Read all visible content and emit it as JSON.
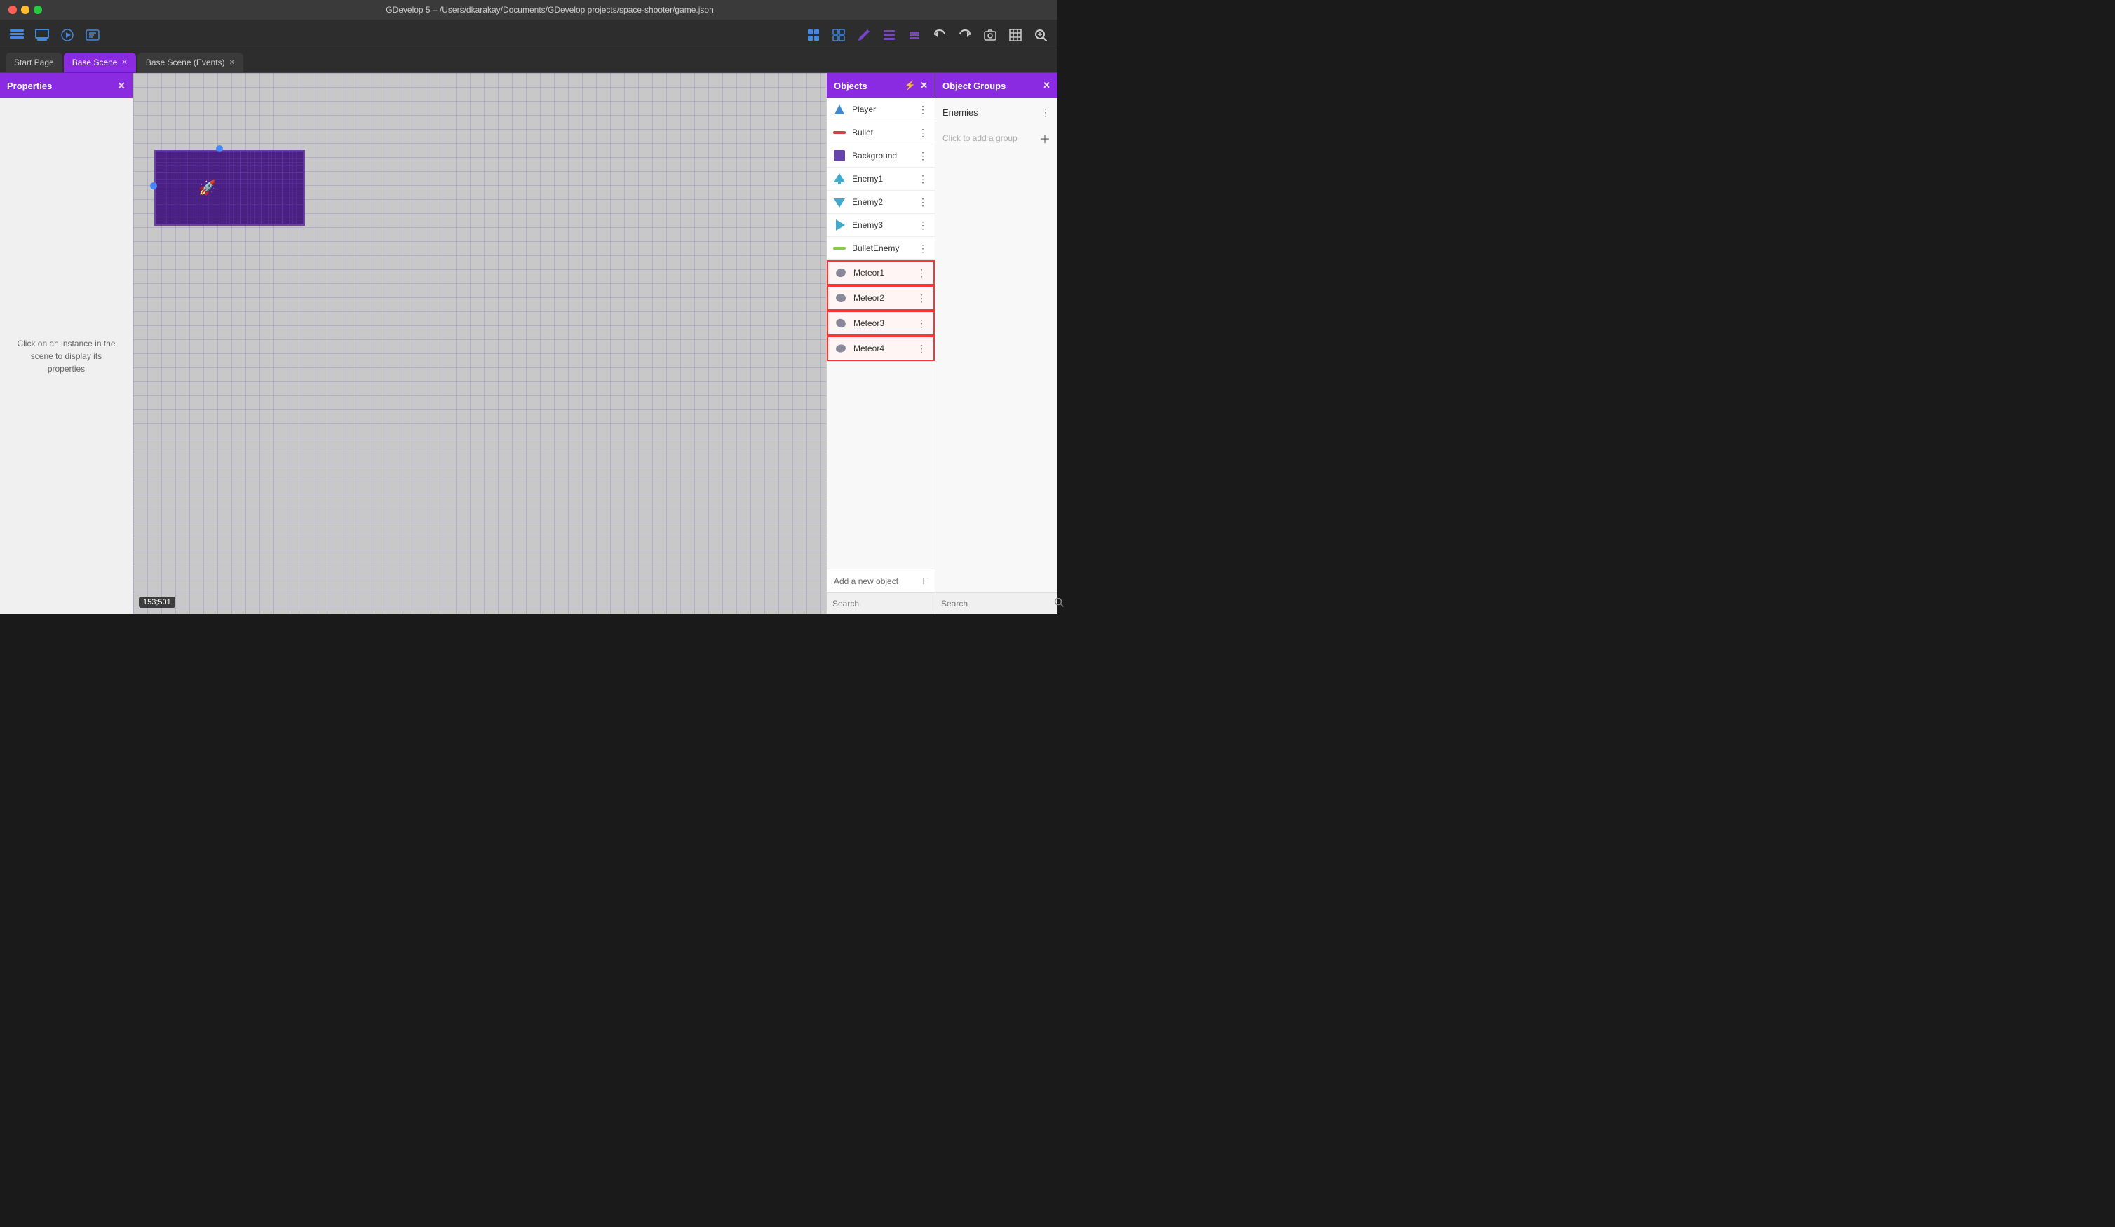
{
  "titlebar": {
    "title": "GDevelop 5 – /Users/dkarakay/Documents/GDevelop projects/space-shooter/game.json"
  },
  "toolbar": {
    "left_buttons": [
      {
        "name": "file-icon",
        "icon": "☰",
        "label": "File"
      },
      {
        "name": "scene-icon",
        "icon": "⬛",
        "label": "Scene"
      },
      {
        "name": "play-icon",
        "icon": "▶",
        "label": "Play"
      },
      {
        "name": "events-icon",
        "icon": "⚡",
        "label": "Events"
      }
    ],
    "right_buttons": [
      {
        "name": "objects-icon",
        "icon": "🔷",
        "label": "Objects"
      },
      {
        "name": "groups-icon",
        "icon": "🔶",
        "label": "Groups"
      },
      {
        "name": "pencil-icon",
        "icon": "✏️",
        "label": "Edit"
      },
      {
        "name": "list-icon",
        "icon": "☰",
        "label": "List"
      },
      {
        "name": "layers-icon",
        "icon": "⧉",
        "label": "Layers"
      },
      {
        "name": "undo-icon",
        "icon": "↩",
        "label": "Undo"
      },
      {
        "name": "redo-icon",
        "icon": "↪",
        "label": "Redo"
      },
      {
        "name": "screenshot-icon",
        "icon": "📷",
        "label": "Screenshot"
      },
      {
        "name": "grid-icon",
        "icon": "⊞",
        "label": "Grid"
      },
      {
        "name": "zoom-icon",
        "icon": "🔍",
        "label": "Zoom"
      }
    ]
  },
  "tabs": [
    {
      "label": "Start Page",
      "active": false,
      "closable": false
    },
    {
      "label": "Base Scene",
      "active": true,
      "closable": true
    },
    {
      "label": "Base Scene (Events)",
      "active": false,
      "closable": true
    }
  ],
  "properties_panel": {
    "title": "Properties",
    "hint": "Click on an instance in the scene to display its properties"
  },
  "scene": {
    "coords": "153;501"
  },
  "objects_panel": {
    "title": "Objects",
    "items": [
      {
        "name": "Player",
        "icon_color": "#4488cc",
        "icon_type": "player"
      },
      {
        "name": "Bullet",
        "icon_color": "#cc4444",
        "icon_type": "bullet"
      },
      {
        "name": "Background",
        "icon_color": "#6644aa",
        "icon_type": "rect"
      },
      {
        "name": "Enemy1",
        "icon_color": "#44aacc",
        "icon_type": "enemy"
      },
      {
        "name": "Enemy2",
        "icon_color": "#44aacc",
        "icon_type": "enemy"
      },
      {
        "name": "Enemy3",
        "icon_color": "#44aacc",
        "icon_type": "enemy"
      },
      {
        "name": "BulletEnemy",
        "icon_color": "#88cc44",
        "icon_type": "bullet"
      },
      {
        "name": "Meteor1",
        "icon_color": "#888899",
        "icon_type": "meteor",
        "selected_group": true
      },
      {
        "name": "Meteor2",
        "icon_color": "#888899",
        "icon_type": "meteor",
        "selected_group": true
      },
      {
        "name": "Meteor3",
        "icon_color": "#888899",
        "icon_type": "meteor",
        "selected_group": true
      },
      {
        "name": "Meteor4",
        "icon_color": "#888899",
        "icon_type": "meteor",
        "selected_group": true
      }
    ],
    "add_label": "Add a new object",
    "search_placeholder": "Search"
  },
  "groups_panel": {
    "title": "Object Groups",
    "groups": [
      {
        "name": "Enemies"
      }
    ],
    "click_to_add": "Click to add a group",
    "search_placeholder": "Search"
  }
}
